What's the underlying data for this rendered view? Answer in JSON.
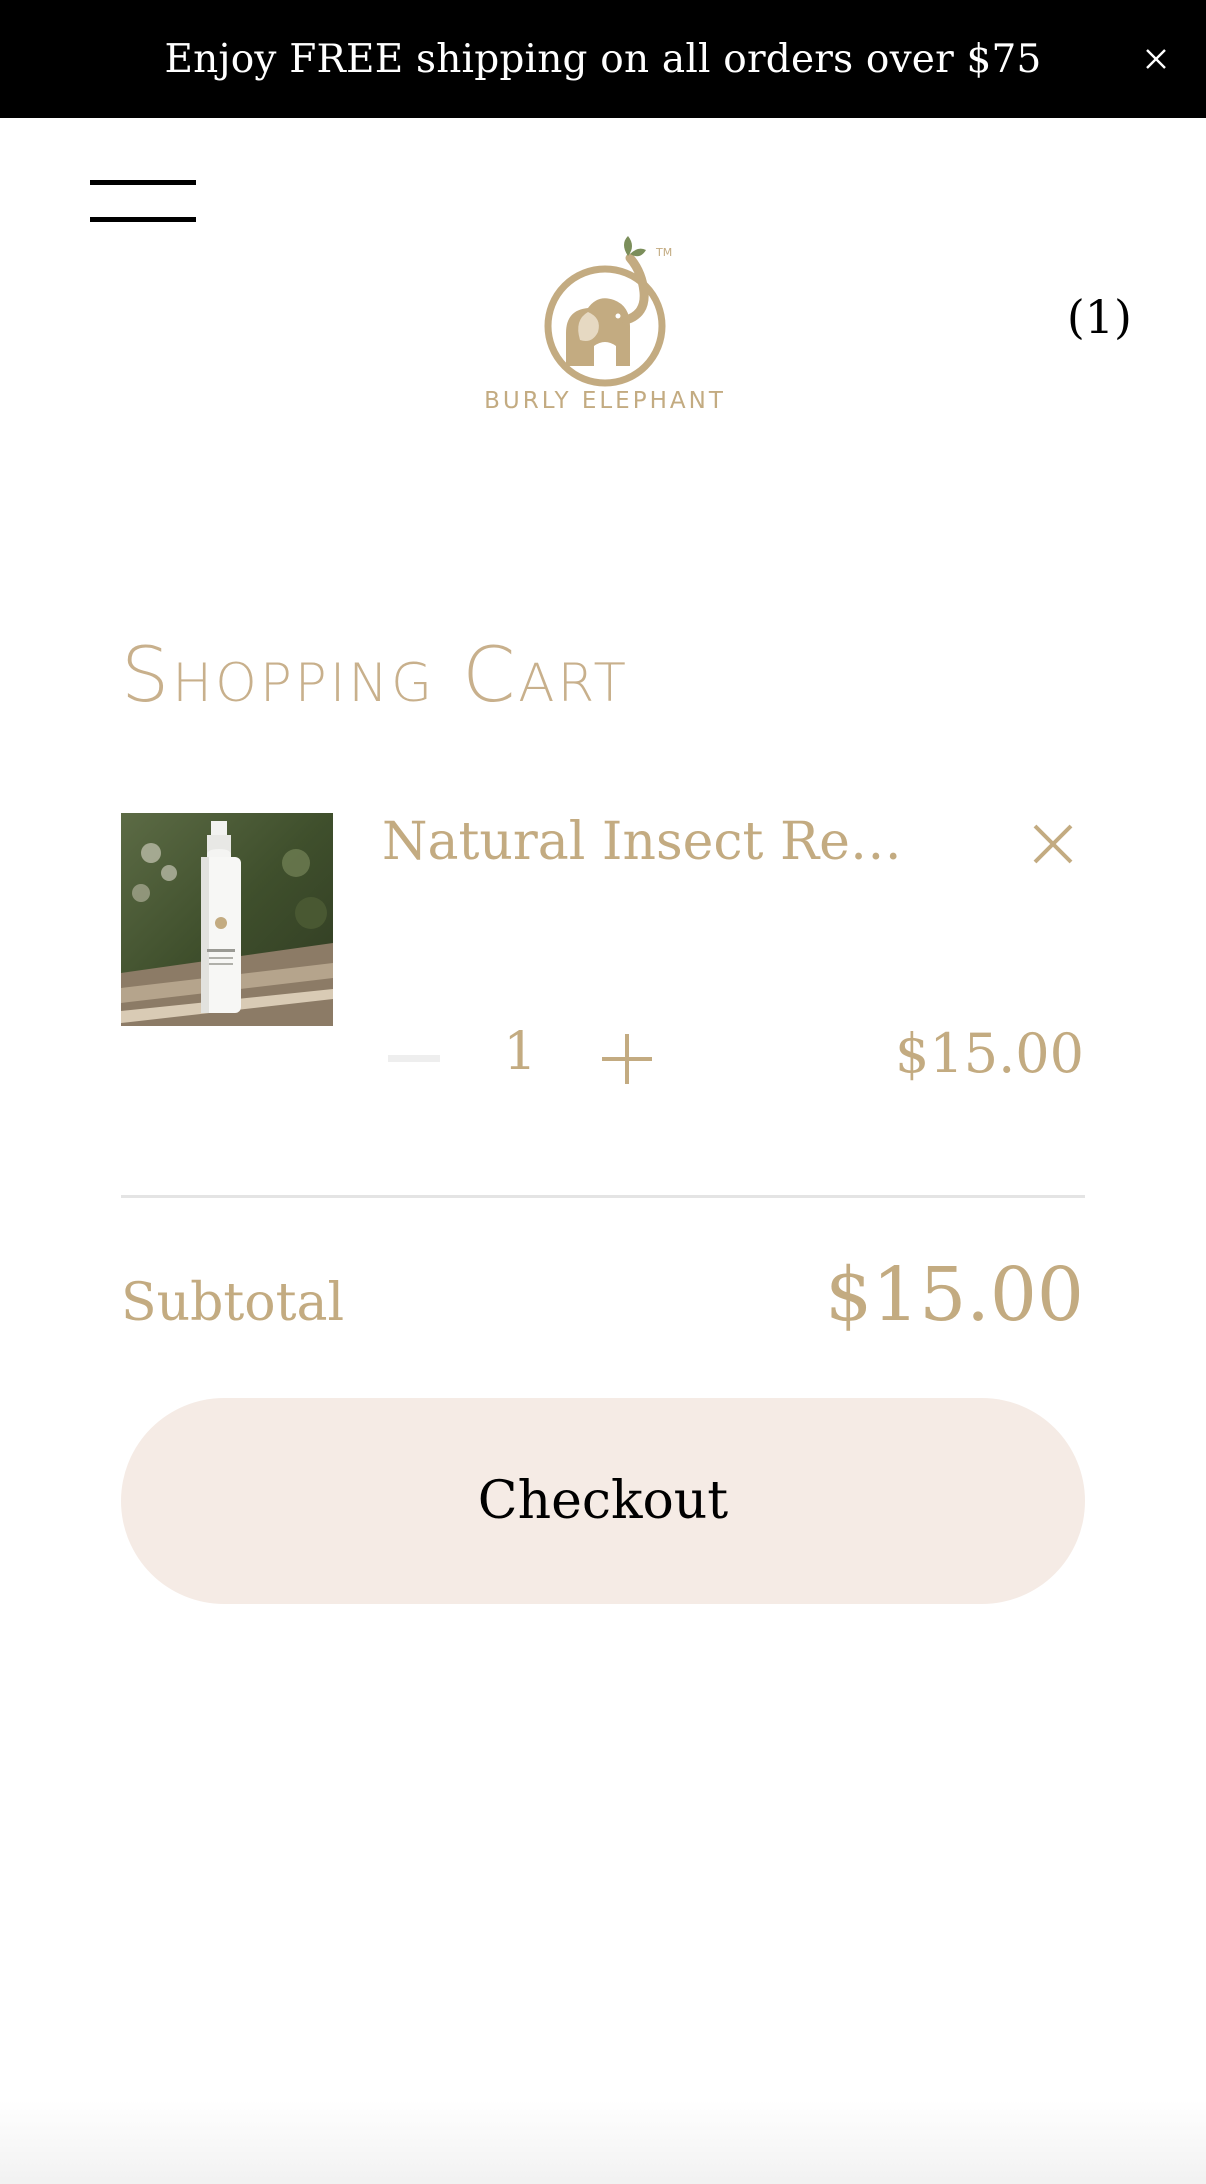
{
  "announcement": {
    "text": "Enjoy FREE shipping on all orders over $75",
    "close_icon": "close-icon"
  },
  "header": {
    "menu_icon": "hamburger-menu-icon",
    "logo_text": "BURLY ELEPHANT",
    "logo_trademark": "TM",
    "cart_count": "(1)"
  },
  "cart": {
    "title": "Shopping Cart",
    "items": [
      {
        "name": "Natural Insect Repel...",
        "quantity": "1",
        "price": "$15.00",
        "remove_icon": "close-icon",
        "minus_icon": "minus-icon",
        "plus_icon": "plus-icon"
      }
    ],
    "subtotal_label": "Subtotal",
    "subtotal_value": "$15.00",
    "checkout_label": "Checkout"
  },
  "colors": {
    "accent": "#c3ab81",
    "checkout_bg": "#f5ebe5",
    "announcement_bg": "#000000"
  }
}
